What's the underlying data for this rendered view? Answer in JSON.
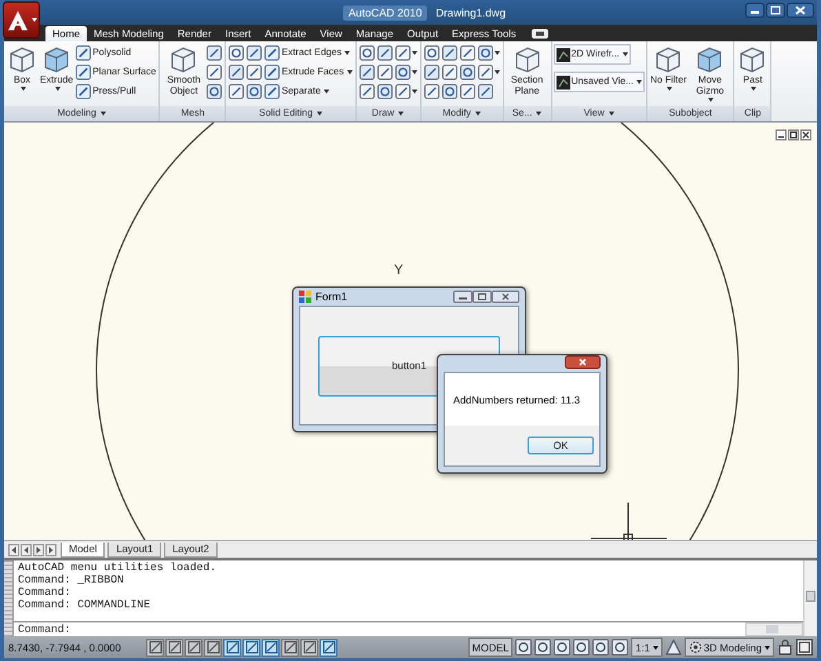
{
  "title_bar": {
    "app": "AutoCAD 2010",
    "document": "Drawing1.dwg"
  },
  "tabs": [
    {
      "label": "Home",
      "selected": true
    },
    {
      "label": "Mesh Modeling",
      "selected": false
    },
    {
      "label": "Render",
      "selected": false
    },
    {
      "label": "Insert",
      "selected": false
    },
    {
      "label": "Annotate",
      "selected": false
    },
    {
      "label": "View",
      "selected": false
    },
    {
      "label": "Manage",
      "selected": false
    },
    {
      "label": "Output",
      "selected": false
    },
    {
      "label": "Express Tools",
      "selected": false
    }
  ],
  "ribbon": {
    "panels": [
      {
        "title": "Modeling",
        "menu": true,
        "columns": [
          [
            {
              "kind": "large",
              "label": "Box",
              "dropdown": true
            }
          ],
          [
            {
              "kind": "large",
              "label": "Extrude",
              "dropdown": true
            }
          ],
          [
            {
              "kind": "small",
              "label": "Polysolid",
              "dropdown": false
            },
            {
              "kind": "small",
              "label": "Planar Surface",
              "dropdown": false
            },
            {
              "kind": "small",
              "label": "Press/Pull",
              "dropdown": false
            }
          ]
        ]
      },
      {
        "title": "Mesh",
        "menu": false,
        "columns": [
          [
            {
              "kind": "large",
              "label": "Smooth Object",
              "dropdown": false
            }
          ],
          [
            {
              "kind": "icon",
              "dropdown": false
            },
            {
              "kind": "icon",
              "dropdown": false
            },
            {
              "kind": "icon",
              "dropdown": false
            }
          ]
        ]
      },
      {
        "title": "Solid Editing",
        "menu": true,
        "columns": [
          [
            {
              "kind": "icon",
              "dropdown": false
            },
            {
              "kind": "icon",
              "dropdown": false
            },
            {
              "kind": "icon",
              "dropdown": false
            }
          ],
          [
            {
              "kind": "icon",
              "dropdown": false
            },
            {
              "kind": "icon",
              "dropdown": false
            },
            {
              "kind": "icon",
              "dropdown": false
            }
          ],
          [
            {
              "kind": "small",
              "label": "Extract Edges",
              "dropdown": true
            },
            {
              "kind": "small",
              "label": "Extrude Faces",
              "dropdown": true
            },
            {
              "kind": "small",
              "label": "Separate",
              "dropdown": true
            }
          ]
        ]
      },
      {
        "title": "Draw",
        "menu": true,
        "columns": [
          [
            {
              "kind": "icon",
              "dropdown": false
            },
            {
              "kind": "icon",
              "dropdown": false
            },
            {
              "kind": "icon",
              "dropdown": false
            }
          ],
          [
            {
              "kind": "icon",
              "dropdown": false
            },
            {
              "kind": "icon",
              "dropdown": false
            },
            {
              "kind": "icon",
              "dropdown": false
            }
          ],
          [
            {
              "kind": "icon",
              "dropdown": true
            },
            {
              "kind": "icon",
              "dropdown": true
            },
            {
              "kind": "icon",
              "dropdown": true
            }
          ]
        ]
      },
      {
        "title": "Modify",
        "menu": true,
        "columns": [
          [
            {
              "kind": "icon",
              "dropdown": false
            },
            {
              "kind": "icon",
              "dropdown": false
            },
            {
              "kind": "icon",
              "dropdown": false
            }
          ],
          [
            {
              "kind": "icon",
              "dropdown": false
            },
            {
              "kind": "icon",
              "dropdown": false
            },
            {
              "kind": "icon",
              "dropdown": false
            }
          ],
          [
            {
              "kind": "icon",
              "dropdown": false
            },
            {
              "kind": "icon",
              "dropdown": false
            },
            {
              "kind": "icon",
              "dropdown": false
            }
          ],
          [
            {
              "kind": "icon",
              "dropdown": true
            },
            {
              "kind": "icon",
              "dropdown": true
            },
            {
              "kind": "icon",
              "dropdown": false
            }
          ]
        ]
      },
      {
        "title": "Se...",
        "menu": true,
        "columns": [
          [
            {
              "kind": "large",
              "label": "Section Plane",
              "dropdown": false
            }
          ]
        ]
      },
      {
        "title": "View",
        "menu": true,
        "columns": [
          [
            {
              "kind": "combo",
              "label": "2D Wirefr..."
            },
            {
              "kind": "combo",
              "label": "Unsaved Vie..."
            }
          ]
        ]
      },
      {
        "title": "Subobject",
        "menu": false,
        "columns": [
          [
            {
              "kind": "large",
              "label": "No Filter",
              "dropdown": true
            }
          ],
          [
            {
              "kind": "large",
              "label": "Move Gizmo",
              "dropdown": true
            }
          ]
        ]
      },
      {
        "title": "Clip",
        "menu": false,
        "columns": [
          [
            {
              "kind": "large",
              "label": "Past",
              "dropdown": true
            }
          ]
        ]
      }
    ]
  },
  "drawing": {
    "ucs_label": "Y"
  },
  "form": {
    "title": "Form1",
    "button": "button1"
  },
  "message_box": {
    "text": "AddNumbers returned: 11.3",
    "button": "OK"
  },
  "layout_tabs": [
    {
      "label": "Model",
      "selected": true
    },
    {
      "label": "Layout1",
      "selected": false
    },
    {
      "label": "Layout2",
      "selected": false
    }
  ],
  "command_line": {
    "history": [
      "AutoCAD menu utilities loaded.",
      "Command: _RIBBON",
      "Command:",
      "Command: COMMANDLINE"
    ],
    "prompt": "Command:"
  },
  "status_bar": {
    "coordinates": "8.7430, -7.7944 , 0.0000",
    "toggles": [
      {
        "on": false
      },
      {
        "on": false
      },
      {
        "on": false
      },
      {
        "on": false
      },
      {
        "on": true
      },
      {
        "on": true
      },
      {
        "on": true
      },
      {
        "on": false
      },
      {
        "on": false
      },
      {
        "on": true
      }
    ],
    "space": "MODEL",
    "scale": "1:1",
    "workspace": "3D Modeling"
  }
}
